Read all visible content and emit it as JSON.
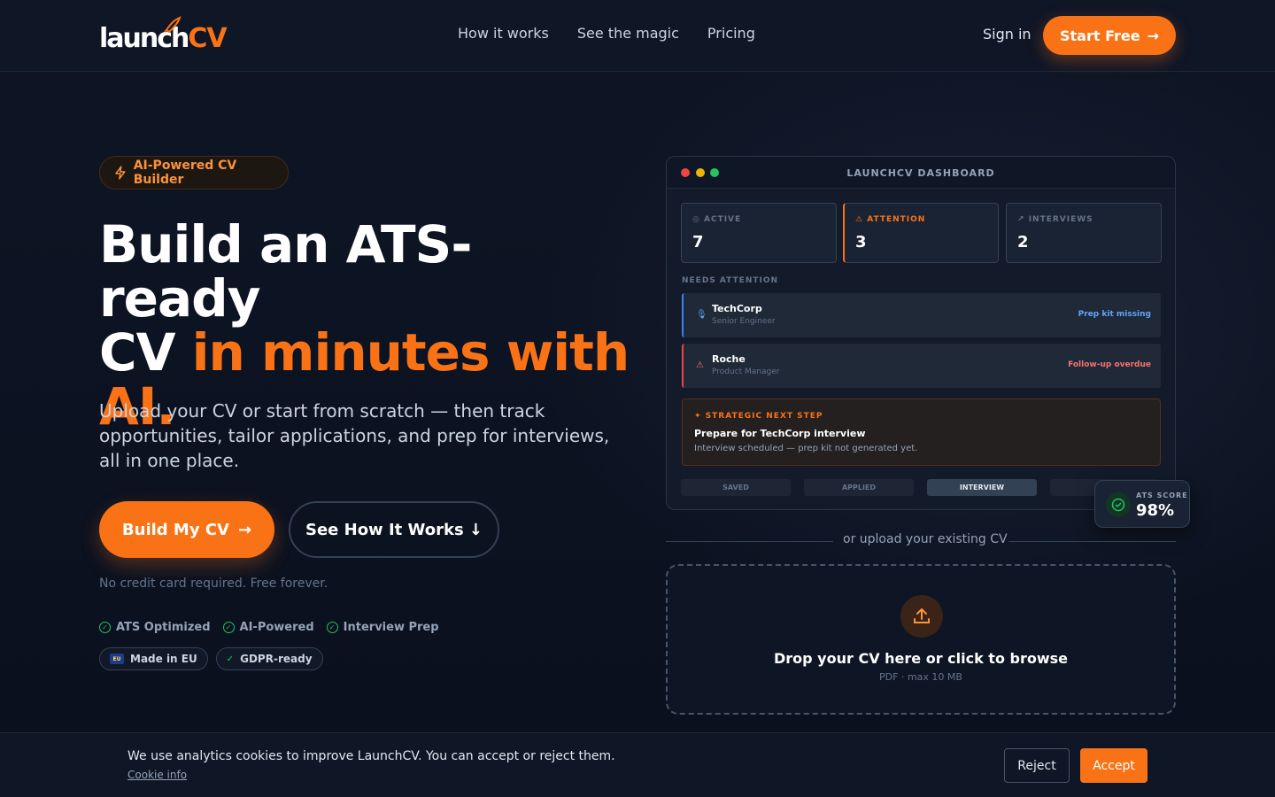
{
  "brand": {
    "logo_part1": "launch",
    "logo_part2": "CV",
    "accent": "#f97316"
  },
  "nav": {
    "items": [
      "How it works",
      "See the magic",
      "Pricing"
    ],
    "sign_in": "Sign in",
    "cta": "Start Free"
  },
  "hero": {
    "badge": "AI-Powered CV Builder",
    "title_line1": "Build an ATS-ready",
    "title_line2_a": "CV ",
    "title_line2_b": "in minutes with",
    "title_line3": "AI.",
    "subtitle": "Upload your CV or start from scratch — then track opportunities, tailor applications, and prep for interviews, all in one place.",
    "primary_cta": "Build My CV",
    "secondary_cta": "See How It Works ↓",
    "note": "No credit card required. Free forever.",
    "features": [
      "ATS Optimized",
      "AI-Powered",
      "Interview Prep"
    ],
    "pills": [
      "Made in EU",
      "GDPR-ready"
    ],
    "eu_label": "EU"
  },
  "dashboard": {
    "title": "LAUNCHCV DASHBOARD",
    "stats": [
      {
        "label": "ACTIVE",
        "value": "7"
      },
      {
        "label": "ATTENTION",
        "value": "3"
      },
      {
        "label": "INTERVIEWS",
        "value": "2"
      }
    ],
    "section_label": "NEEDS ATTENTION",
    "rows": [
      {
        "company": "TechCorp",
        "role": "Senior Engineer",
        "status": "Prep kit missing"
      },
      {
        "company": "Roche",
        "role": "Product Manager",
        "status": "Follow-up overdue"
      }
    ],
    "next_step": {
      "label": "STRATEGIC NEXT STEP",
      "title": "Prepare for TechCorp interview",
      "detail": "Interview scheduled — prep kit not generated yet."
    },
    "pipeline": [
      "SAVED",
      "APPLIED",
      "INTERVIEW",
      ""
    ],
    "ats": {
      "label": "ATS SCORE",
      "value": "98%"
    }
  },
  "upload": {
    "divider_text": "or upload your existing CV",
    "title": "Drop your CV here or click to browse",
    "hint": "PDF · max 10 MB"
  },
  "cookie": {
    "message": "We use analytics cookies to improve LaunchCV. You can accept or reject them.",
    "link": "Cookie info",
    "reject": "Reject",
    "accept": "Accept"
  }
}
